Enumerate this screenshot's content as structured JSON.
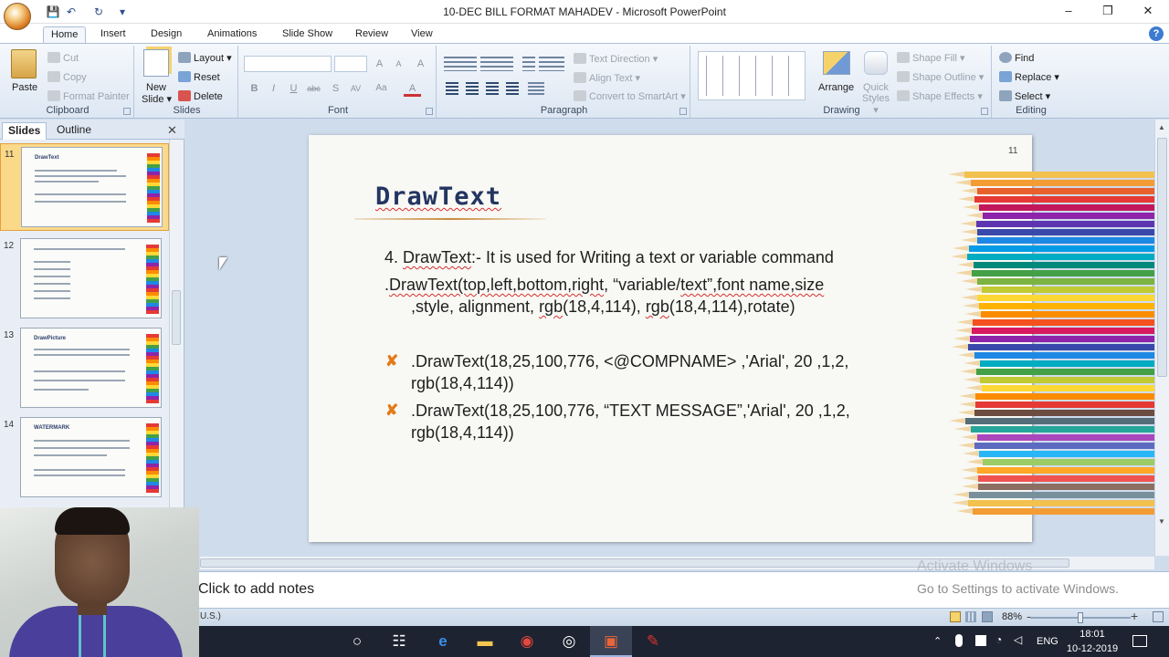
{
  "window": {
    "title": "10-DEC BILL FORMAT MAHADEV - Microsoft PowerPoint",
    "minimize": "–",
    "restore": "❐",
    "close": "✕"
  },
  "qat": {
    "save": "💾",
    "undo": "↶",
    "redo": "↻",
    "customize": "▾"
  },
  "tabs": [
    "Home",
    "Insert",
    "Design",
    "Animations",
    "Slide Show",
    "Review",
    "View"
  ],
  "help": "?",
  "ribbon": {
    "clipboard": {
      "label": "Clipboard",
      "paste": "Paste",
      "cut": "Cut",
      "copy": "Copy",
      "format_painter": "Format Painter"
    },
    "slides": {
      "label": "Slides",
      "new_slide_1": "New",
      "new_slide_2": "Slide ▾",
      "layout": "Layout ▾",
      "reset": "Reset",
      "delete": "Delete"
    },
    "font": {
      "label": "Font",
      "font_name": "",
      "font_size": "",
      "grow": "A",
      "shrink": "A",
      "clear": "A",
      "bold": "B",
      "italic": "I",
      "underline": "U",
      "strike": "abc",
      "shadow": "S",
      "spacing": "AV",
      "case": "Aa",
      "color": "A"
    },
    "paragraph": {
      "label": "Paragraph",
      "text_direction": "Text Direction ▾",
      "align_text": "Align Text ▾",
      "smartart": "Convert to SmartArt ▾"
    },
    "drawing": {
      "label": "Drawing",
      "arrange": "Arrange",
      "quick_styles": "Quick Styles ▾",
      "fill": "Shape Fill ▾",
      "outline": "Shape Outline ▾",
      "effects": "Shape Effects ▾"
    },
    "editing": {
      "label": "Editing",
      "find": "Find",
      "replace": "Replace ▾",
      "select": "Select ▾"
    }
  },
  "panel": {
    "tabs": [
      "Slides",
      "Outline"
    ],
    "close": "✕",
    "thumbnails": [
      {
        "num": "11",
        "title": "DrawText",
        "selected": true
      },
      {
        "num": "12",
        "title": "",
        "selected": false
      },
      {
        "num": "13",
        "title": "DrawPicture",
        "selected": false
      },
      {
        "num": "14",
        "title": "WATERMARK",
        "selected": false
      }
    ]
  },
  "slide": {
    "number": "11",
    "title": "DrawText",
    "line1_num": "4. ",
    "line1_name": "DrawText",
    "line1_rest": ":- It is used for Writing a text or variable command",
    "line2_a": ".",
    "line2_b": "DrawText(top,left,bottom,right",
    "line2_c": ", “variable/",
    "line2_d": "text”,font name,size",
    "line3_a": ",style, alignment, ",
    "line3_b": "rgb",
    "line3_c": "(18,4,114), ",
    "line3_d": "rgb",
    "line3_e": "(18,4,114),rotate)",
    "bullets": [
      {
        "mark": "✘",
        "line1": ".DrawText(18,25,100,776, <@COMPNAME>   ,'Arial', 20 ,1,2,",
        "line2": "rgb(18,4,114))"
      },
      {
        "mark": "✘",
        "line1": ".DrawText(18,25,100,776, “TEXT  MESSAGE”,'Arial', 20 ,1,2,",
        "line2": "rgb(18,4,114))"
      }
    ]
  },
  "notes": {
    "placeholder": "Click to add notes"
  },
  "watermark": {
    "line1": "Activate Windows",
    "line2": "Go to Settings to activate Windows."
  },
  "status": {
    "language": "U.S.)",
    "zoom": "88%",
    "zoom_out": "−",
    "zoom_in": "+"
  },
  "taskbar": {
    "lang": "ENG",
    "time": "18:01",
    "date": "10-12-2019"
  },
  "colors": {
    "accent": "#e37b17",
    "title": "#233561",
    "ribbon": "#dde7f3",
    "taskbar": "#1d2330"
  }
}
